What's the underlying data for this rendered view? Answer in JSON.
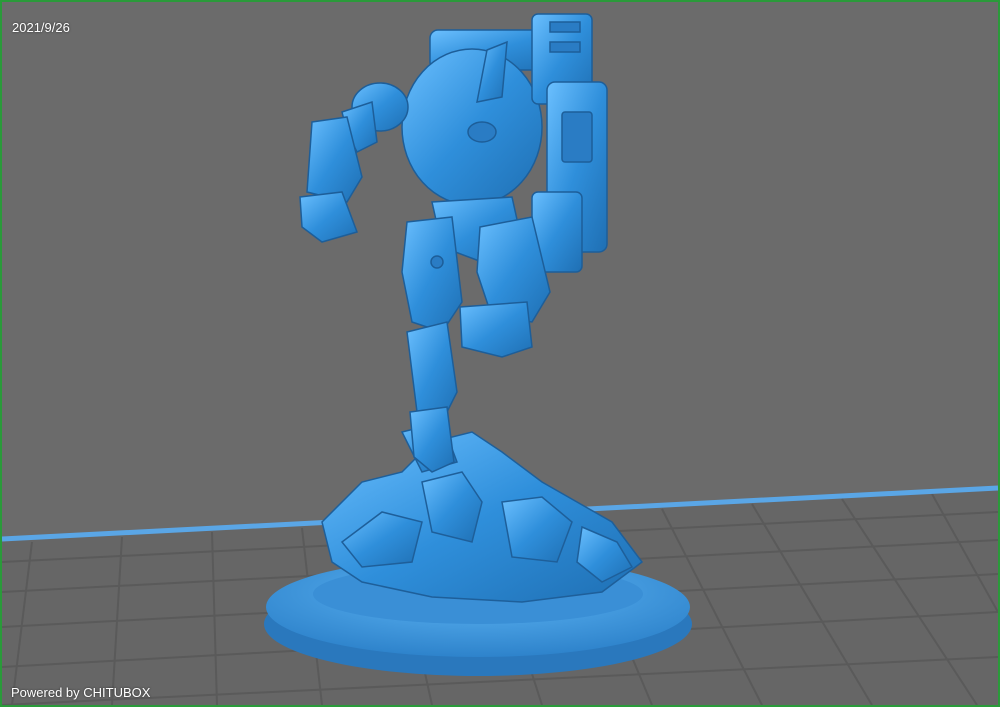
{
  "viewport": {
    "date_label": "2021/9/26",
    "powered_label": "Powered by CHITUBOX"
  },
  "colors": {
    "background": "#6b6b6b",
    "frame": "#2a9a3a",
    "model": "#3d9be0",
    "grid": "#555555",
    "plate_edge": "#5aa6e6"
  },
  "model": {
    "name": "robot-mech-miniature-icon"
  }
}
